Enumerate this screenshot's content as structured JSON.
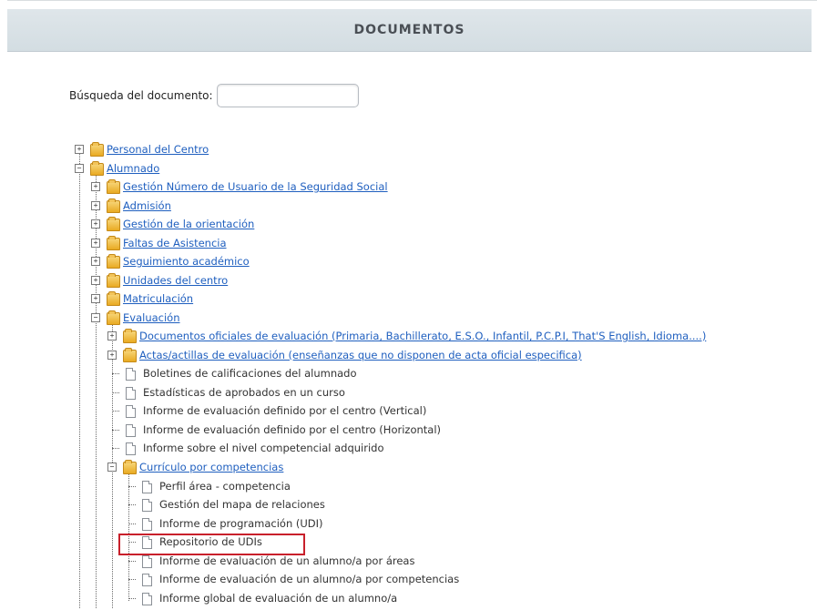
{
  "header": {
    "title": "DOCUMENTOS"
  },
  "search": {
    "label": "Búsqueda del documento:",
    "value": ""
  },
  "tree": {
    "personal": "Personal del Centro",
    "alumnado": "Alumnado",
    "alumnado_children": [
      "Gestión Número de Usuario de la Seguridad Social",
      "Admisión",
      "Gestión de la orientación",
      "Faltas de Asistencia",
      "Seguimiento académico",
      "Unidades del centro",
      "Matriculación"
    ],
    "evaluacion": "Evaluación",
    "evaluacion_folders": [
      "Documentos oficiales de evaluación (Primaria, Bachillerato, E.S.O., Infantil, P.C.P.I, That'S English, Idioma....)",
      "Actas/actillas de evaluación (enseñanzas que no disponen de acta oficial especifica)"
    ],
    "evaluacion_docs": [
      "Boletines de calificaciones del alumnado",
      "Estadísticas de aprobados en un curso",
      "Informe de evaluación definido por el centro (Vertical)",
      "Informe de evaluación definido por el centro (Horizontal)",
      "Informe sobre el nivel competencial adquirido"
    ],
    "curriculo": "Currículo por competencias",
    "curriculo_docs": [
      "Perfil área - competencia",
      "Gestión del mapa de relaciones",
      "Informe de programación (UDI)",
      "Repositorio de UDIs",
      "Informe de evaluación de un alumno/a por áreas",
      "Informe de evaluación de un alumno/a por competencias",
      "Informe global de evaluación de un alumno/a"
    ]
  },
  "icons": {
    "folder": "folder-icon",
    "document": "document-icon",
    "expand": "plus-box-icon",
    "collapse": "minus-box-icon"
  },
  "colors": {
    "link": "#1f5fbf",
    "highlight": "#c8202b",
    "header_bg": "#d9e2e6"
  }
}
